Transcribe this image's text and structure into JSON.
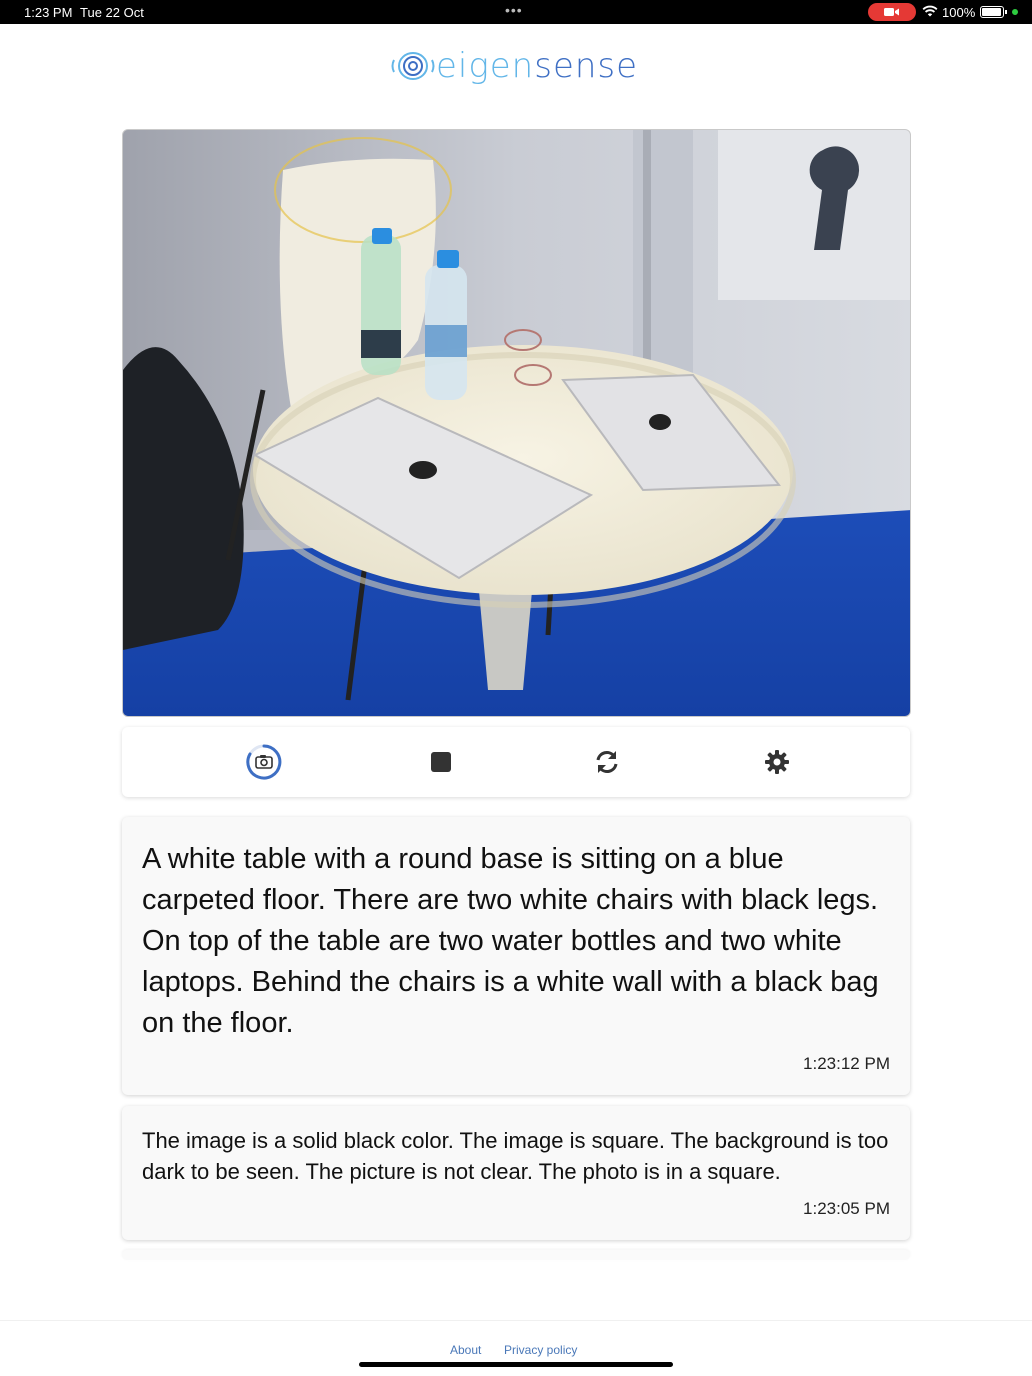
{
  "status_bar": {
    "time": "1:23 PM",
    "date": "Tue 22 Oct",
    "battery": "100%",
    "icons": [
      "camera-recording-icon",
      "wifi-icon",
      "battery-icon"
    ]
  },
  "header": {
    "logo_part_1": "eigen",
    "logo_part_2": "sense",
    "logo_icon": "eigensense-logo-icon"
  },
  "toolbar": {
    "buttons": [
      {
        "icon": "camera-icon",
        "state": "active"
      },
      {
        "icon": "stop-icon"
      },
      {
        "icon": "refresh-icon"
      },
      {
        "icon": "gear-icon"
      }
    ],
    "accent": "#3e6fc4"
  },
  "results": [
    {
      "description": "A white table with a round base is sitting on a blue carpeted floor. There are two white chairs with black legs. On top of the table are two water bottles and two white laptops. Behind the chairs is a white wall with a black bag on the floor.",
      "timestamp": "1:23:12 PM"
    },
    {
      "description": "The image is a solid black color. The image is square. The background is too dark to be seen. The picture is not clear. The photo is in a square.",
      "timestamp": "1:23:05 PM"
    }
  ],
  "footer": {
    "about": "About",
    "privacy": "Privacy policy"
  },
  "colors": {
    "logo_light": "#62b6e8",
    "logo_dark": "#3e6fc4",
    "link": "#4a78b8",
    "floor_blue": "#1f4fb8"
  }
}
